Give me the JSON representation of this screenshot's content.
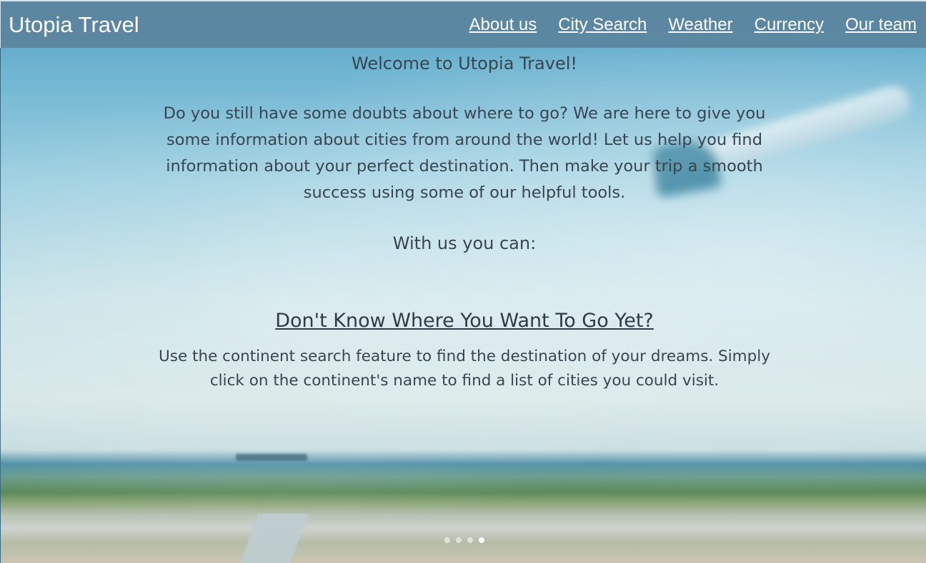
{
  "navbar": {
    "brand": "Utopia Travel",
    "links": [
      "About us",
      "City Search",
      "Weather",
      "Currency",
      "Our team"
    ]
  },
  "main": {
    "welcome": "Welcome to Utopia Travel!",
    "intro": "Do you still have some doubts about where to go? We are here to give you some information about cities from around the world! Let us help you find information about your perfect destination. Then make your trip a smooth success using some of our helpful tools.",
    "with_us": "With us you can:"
  },
  "carousel": {
    "title": "Don't Know Where You Want To Go Yet?",
    "text": "Use the continent search feature to find the destination of your dreams. Simply click on the continent's name to find a list of cities you could visit.",
    "slide_count": 4,
    "active_index": 3
  },
  "colors": {
    "navbar_bg": "#5c849e",
    "text": "#394551",
    "link": "#ffffff"
  }
}
